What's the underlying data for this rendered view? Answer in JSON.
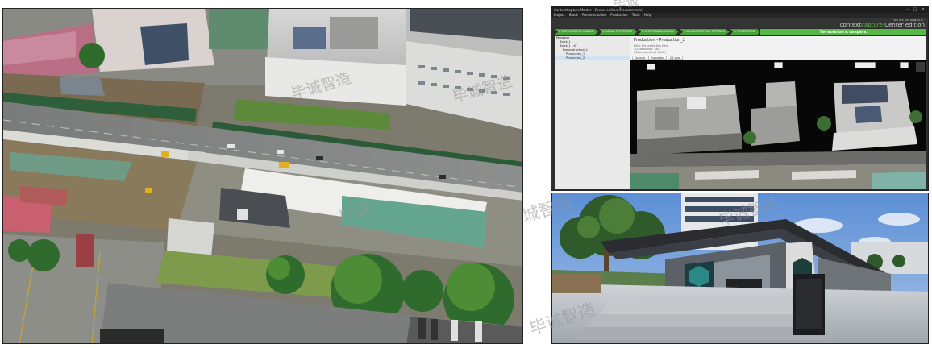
{
  "watermark": {
    "text": "毕诚智造",
    "text_cut": "毕诚",
    "text_mid": "城智造"
  },
  "app": {
    "title": "ContextCapture Master - Center edition (Mosaster.ccm)",
    "window_controls": "–  □  ✕",
    "menu": [
      "Project",
      "Block",
      "Reconstruction",
      "Production",
      "Tools",
      "Help"
    ],
    "brand": {
      "prefix": "context",
      "accent": "capture",
      "edition": "Center edition"
    },
    "notice": "You are not logged in",
    "workflow_steps": [
      "1. PHOTOGRAPHS LOADED",
      "2. AERIAL PROPERTIES",
      "3. AEROTRIANGULATION",
      "4. RECONSTRUCTION SETTINGS",
      "5. PRODUCTION"
    ],
    "workflow_status": "The workflow is complete.",
    "tree": [
      {
        "label": "Mosaster",
        "indent": 0,
        "selected": false
      },
      {
        "label": "Block_1",
        "indent": 1,
        "selected": false
      },
      {
        "label": "Block_1 - AT",
        "indent": 1,
        "selected": false
      },
      {
        "label": "Reconstruction_1",
        "indent": 2,
        "selected": false
      },
      {
        "label": "Production_1",
        "indent": 3,
        "selected": false
      },
      {
        "label": "Production_2",
        "indent": 3,
        "selected": true
      }
    ],
    "panel_title": "Production - Production_2",
    "panel_lines": [
      "Enter the production here",
      "3D production: 3MX",
      "100 production_2 (3MX)"
    ],
    "tabs": [
      "General",
      "Properties",
      "3D view"
    ]
  },
  "colors": {
    "accent_green": "#58b847",
    "window_dark": "#2e2e2e",
    "sky_blue": "#6d9ad8"
  },
  "icons": [
    "window-close-icon",
    "tree-folder-icon",
    "tab-3d-icon",
    "viewport-home-icon",
    "viewport-tool-icon"
  ]
}
